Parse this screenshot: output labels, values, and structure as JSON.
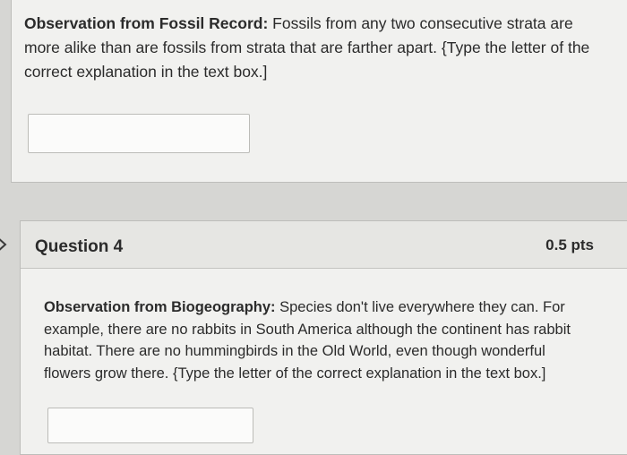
{
  "question3": {
    "label_bold": "Observation from Fossil Record:",
    "text": " Fossils from any two consecutive strata are more alike than are fossils from strata that are farther apart. {Type the letter of the correct explanation in the text box.]",
    "answer_value": ""
  },
  "question4": {
    "title": "Question 4",
    "points": "0.5 pts",
    "label_bold": "Observation from Biogeography:",
    "text": " Species don't live everywhere they can. For example, there are no rabbits in South America although the continent has rabbit habitat. There are no hummingbirds in the Old World, even though wonderful flowers grow there.  {Type the letter of the correct explanation in the text box.]",
    "answer_value": ""
  },
  "icons": {
    "question_nav": "chevron-right-icon"
  }
}
